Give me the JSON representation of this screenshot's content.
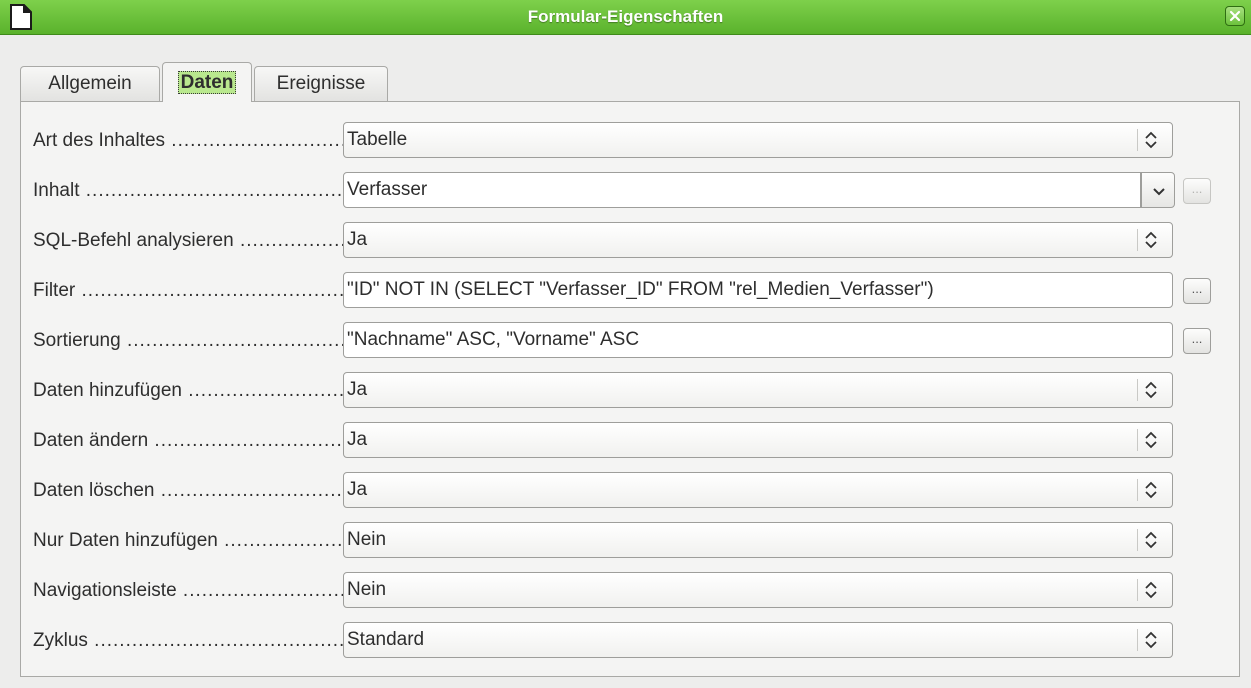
{
  "window": {
    "title": "Formular-Eigenschaften"
  },
  "tabs": [
    {
      "label": "Allgemein"
    },
    {
      "label": "Daten"
    },
    {
      "label": "Ereignisse"
    }
  ],
  "rows": {
    "art": {
      "label": "Art des Inhaltes",
      "value": "Tabelle"
    },
    "inhalt": {
      "label": "Inhalt",
      "value": "Verfasser",
      "button": "..."
    },
    "sql": {
      "label": "SQL-Befehl analysieren",
      "value": "Ja"
    },
    "filter": {
      "label": "Filter",
      "value": "\"ID\" NOT IN (SELECT \"Verfasser_ID\" FROM \"rel_Medien_Verfasser\")",
      "button": "..."
    },
    "sort": {
      "label": "Sortierung",
      "value": "\"Nachname\" ASC, \"Vorname\" ASC",
      "button": "..."
    },
    "add": {
      "label": "Daten hinzufügen",
      "value": "Ja"
    },
    "change": {
      "label": "Daten ändern",
      "value": "Ja"
    },
    "del": {
      "label": "Daten löschen",
      "value": "Ja"
    },
    "addonly": {
      "label": "Nur Daten hinzufügen",
      "value": "Nein"
    },
    "nav": {
      "label": "Navigationsleiste",
      "value": "Nein"
    },
    "cycle": {
      "label": "Zyklus",
      "value": "Standard"
    }
  },
  "colors": {
    "titlebar": "#6cc23c",
    "active_tab_highlight": "#b9e88e"
  }
}
